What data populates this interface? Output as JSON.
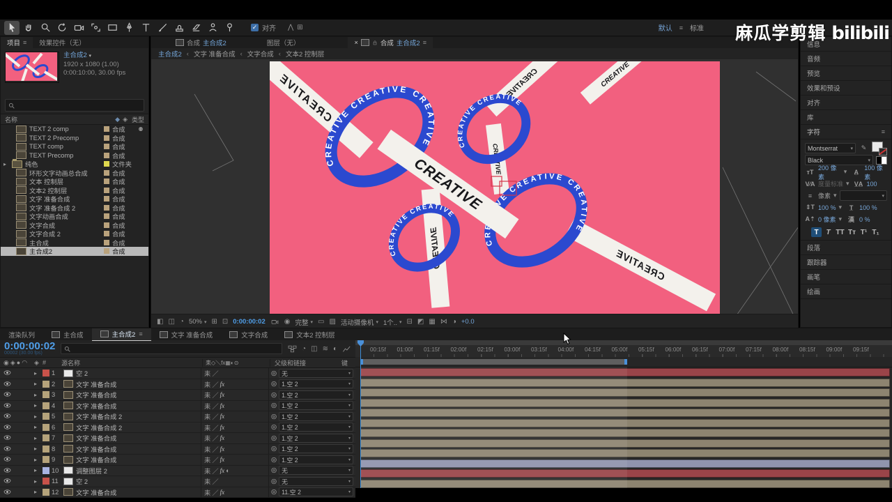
{
  "watermark": {
    "channel": "麻瓜学剪辑",
    "site": "bilibili"
  },
  "topbar": {
    "tools": [
      "selection",
      "hand",
      "zoom",
      "rotate",
      "camera",
      "pan-behind",
      "rect",
      "pen",
      "type",
      "brush",
      "stamp",
      "eraser",
      "roto-brush",
      "puppet-pin"
    ],
    "snap_label": "对齐",
    "workspace": "默认",
    "workspace_mode": "标准"
  },
  "project": {
    "tabs": [
      {
        "label": "项目",
        "active": true,
        "menu": true
      },
      {
        "label": "效果控件（无）",
        "active": false,
        "menu": false
      }
    ],
    "comp_name": "主合成2",
    "comp_meta1": "1920 x 1080 (1.00)",
    "comp_meta2": "0:00:10:00, 30.00 fps",
    "col_name": "名称",
    "col_type": "类型",
    "type_comp": "合成",
    "type_folder": "文件夹",
    "items": [
      {
        "name": "TEXT 2 comp",
        "type": "合成",
        "kind": "comp",
        "badge": true
      },
      {
        "name": "TEXT 2 Precomp",
        "type": "合成",
        "kind": "comp"
      },
      {
        "name": "TEXT comp",
        "type": "合成",
        "kind": "comp"
      },
      {
        "name": "TEXT Precomp",
        "type": "合成",
        "kind": "comp"
      },
      {
        "name": "纯色",
        "type": "文件夹",
        "kind": "folder",
        "expander": true
      },
      {
        "name": "环形文字动画总合成",
        "type": "合成",
        "kind": "comp"
      },
      {
        "name": "文本 控制层",
        "type": "合成",
        "kind": "comp"
      },
      {
        "name": "文本2 控制层",
        "type": "合成",
        "kind": "comp"
      },
      {
        "name": "文字 准备合成",
        "type": "合成",
        "kind": "comp"
      },
      {
        "name": "文字 准备合成 2",
        "type": "合成",
        "kind": "comp"
      },
      {
        "name": "文字动画合成",
        "type": "合成",
        "kind": "comp"
      },
      {
        "name": "文字合成",
        "type": "合成",
        "kind": "comp"
      },
      {
        "name": "文字合成 2",
        "type": "合成",
        "kind": "comp"
      },
      {
        "name": "主合成",
        "type": "合成",
        "kind": "comp"
      },
      {
        "name": "主合成2",
        "type": "合成",
        "kind": "comp",
        "selected": true
      }
    ]
  },
  "viewer": {
    "comp_label": "合成",
    "comp_name": "主合成2",
    "layer_tab": "图层（无）",
    "breadcrumb": [
      "主合成2",
      "文字 准备合成",
      "文字合成",
      "文本2 控制层"
    ],
    "zoom": "50%",
    "time": "0:00:00:02",
    "res": "完整",
    "camera": "活动摄像机",
    "views": "1个..",
    "exposure": "+0.0",
    "comp": {
      "background": "#f2607f",
      "ring_color": "#2b49cf",
      "band_color": "#f3f1ec",
      "band_text_color": "#17171a",
      "label": "CREATIVE"
    }
  },
  "rightbar": {
    "panels_top": [
      "信息",
      "音频",
      "预览",
      "效果和预设",
      "对齐",
      "库"
    ],
    "char_panel": {
      "title": "字符",
      "font": "Montserrat",
      "style": "Black",
      "size": "200 像素",
      "leading": "100 像素",
      "kerning": "度量标准",
      "tracking": "100",
      "unit": "像素",
      "vscale": "100 %",
      "hscale": "100 %",
      "baseline": "0 像素",
      "tsume": "0 %",
      "style_buttons": [
        "T",
        "T",
        "TT",
        "Tт",
        "T¹",
        "T₁"
      ]
    },
    "panels_bottom": [
      "段落",
      "跟踪器",
      "画笔",
      "绘画"
    ]
  },
  "timeline": {
    "tabs": [
      {
        "label": "渲染队列",
        "kind": "queue",
        "active": false
      },
      {
        "label": "主合成",
        "kind": "comp",
        "active": false
      },
      {
        "label": "主合成2",
        "kind": "comp",
        "active": true,
        "menu": true
      },
      {
        "label": "文字 准备合成",
        "kind": "comp",
        "active": false
      },
      {
        "label": "文字合成",
        "kind": "comp",
        "active": false
      },
      {
        "label": "文本2 控制层",
        "kind": "comp",
        "active": false
      }
    ],
    "time": "0:00:00:02",
    "time_sub": "00002 (30.00 fps)",
    "col_source": "源名称",
    "col_parent": "父级和链接",
    "col_key": "键",
    "switch_header": "耒◇＼fx▦◐⊙",
    "ruler": [
      "00:15f",
      "01:00f",
      "01:15f",
      "02:00f",
      "02:15f",
      "03:00f",
      "03:15f",
      "04:00f",
      "04:15f",
      "05:00f",
      "05:15f",
      "06:00f",
      "06:15f",
      "07:00f",
      "07:15f",
      "08:00f",
      "08:15f",
      "09:00f",
      "09:15f"
    ],
    "parent_none": "无",
    "layers": [
      {
        "num": 1,
        "name": "空 2",
        "label": "red",
        "icon": "solid",
        "fx": false,
        "adj": false,
        "parent": "无",
        "bar": "red"
      },
      {
        "num": 2,
        "name": "文字 准备合成",
        "label": "tan",
        "icon": "comp",
        "fx": true,
        "adj": false,
        "parent": "1.空 2",
        "bar": "tan"
      },
      {
        "num": 3,
        "name": "文字 准备合成",
        "label": "tan",
        "icon": "comp",
        "fx": true,
        "adj": false,
        "parent": "1.空 2",
        "bar": "tan"
      },
      {
        "num": 4,
        "name": "文字 准备合成",
        "label": "tan",
        "icon": "comp",
        "fx": true,
        "adj": false,
        "parent": "1.空 2",
        "bar": "tan"
      },
      {
        "num": 5,
        "name": "文字 准备合成 2",
        "label": "tan",
        "icon": "comp",
        "fx": true,
        "adj": false,
        "parent": "1.空 2",
        "bar": "tan"
      },
      {
        "num": 6,
        "name": "文字 准备合成 2",
        "label": "tan",
        "icon": "comp",
        "fx": true,
        "adj": false,
        "parent": "1.空 2",
        "bar": "tan"
      },
      {
        "num": 7,
        "name": "文字 准备合成",
        "label": "tan",
        "icon": "comp",
        "fx": true,
        "adj": false,
        "parent": "1.空 2",
        "bar": "tan"
      },
      {
        "num": 8,
        "name": "文字 准备合成",
        "label": "tan",
        "icon": "comp",
        "fx": true,
        "adj": false,
        "parent": "1.空 2",
        "bar": "tan"
      },
      {
        "num": 9,
        "name": "文字 准备合成",
        "label": "tan",
        "icon": "comp",
        "fx": true,
        "adj": false,
        "parent": "1.空 2",
        "bar": "tan"
      },
      {
        "num": 10,
        "name": "调整图层 2",
        "label": "lavender",
        "icon": "solid",
        "fx": true,
        "adj": true,
        "parent": "无",
        "bar": "lavender"
      },
      {
        "num": 11,
        "name": "空 2",
        "label": "red",
        "icon": "solid",
        "fx": false,
        "adj": false,
        "parent": "无",
        "bar": "red"
      },
      {
        "num": 12,
        "name": "文字 准备合成",
        "label": "tan",
        "icon": "comp",
        "fx": true,
        "adj": false,
        "parent": "11.空 2",
        "bar": "tan"
      }
    ],
    "colors": {
      "bar_red": "#9a4449",
      "bar_tan": "#8d8470",
      "bar_lavender": "#9094ae",
      "label_red": "#c8524a",
      "label_tan": "#b5a37b",
      "label_lavender": "#a9b4e2"
    }
  }
}
